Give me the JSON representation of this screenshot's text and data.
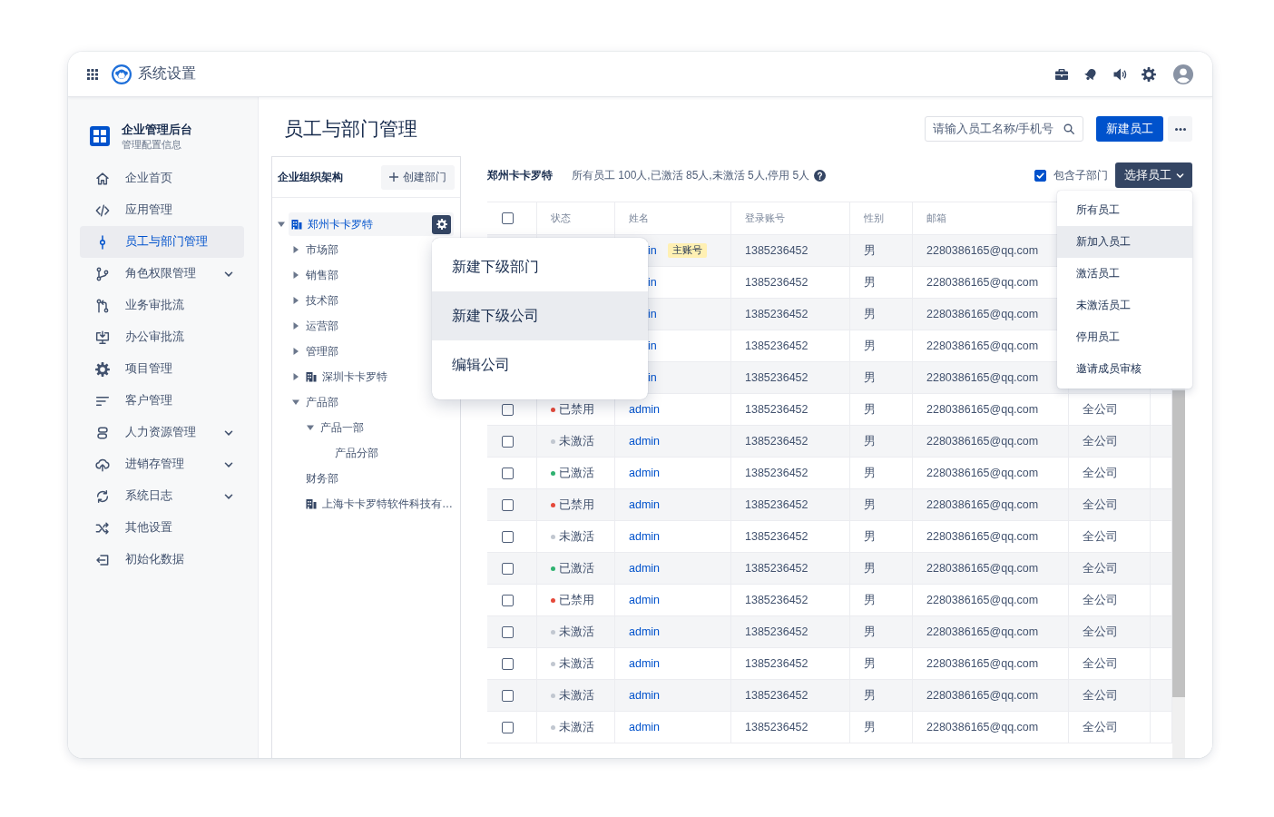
{
  "window": {
    "title": "系统设置"
  },
  "sidebar": {
    "title": "企业管理后台",
    "subtitle": "管理配置信息",
    "items": [
      {
        "label": "企业首页",
        "selected": false,
        "expandable": false
      },
      {
        "label": "应用管理",
        "selected": false,
        "expandable": false
      },
      {
        "label": "员工与部门管理",
        "selected": true,
        "expandable": false
      },
      {
        "label": "角色权限管理",
        "selected": false,
        "expandable": true
      },
      {
        "label": "业务审批流",
        "selected": false,
        "expandable": false
      },
      {
        "label": "办公审批流",
        "selected": false,
        "expandable": false
      },
      {
        "label": "项目管理",
        "selected": false,
        "expandable": false
      },
      {
        "label": "客户管理",
        "selected": false,
        "expandable": false
      },
      {
        "label": "人力资源管理",
        "selected": false,
        "expandable": true
      },
      {
        "label": "进销存管理",
        "selected": false,
        "expandable": true
      },
      {
        "label": "系统日志",
        "selected": false,
        "expandable": true
      },
      {
        "label": "其他设置",
        "selected": false,
        "expandable": false
      },
      {
        "label": "初始化数据",
        "selected": false,
        "expandable": false
      }
    ]
  },
  "page": {
    "title": "员工与部门管理",
    "search": {
      "placeholder": "请输入员工名称/手机号"
    },
    "new_button": "新建员工"
  },
  "org_tree": {
    "title": "企业组织架构",
    "create_button": "创建部门",
    "nodes": [
      {
        "label": "郑州卡卡罗特",
        "kind": "company",
        "selected": true,
        "expanded": true,
        "children": [
          {
            "label": "市场部",
            "kind": "department",
            "selected": false,
            "expanded": false
          },
          {
            "label": "销售部",
            "kind": "department",
            "selected": false,
            "expanded": false
          },
          {
            "label": "技术部",
            "kind": "department",
            "selected": false,
            "expanded": false
          },
          {
            "label": "运营部",
            "kind": "department",
            "selected": false,
            "expanded": false
          },
          {
            "label": "管理部",
            "kind": "department",
            "selected": false,
            "expanded": false
          },
          {
            "label": "深圳卡卡罗特",
            "kind": "company",
            "selected": false,
            "expanded": false
          },
          {
            "label": "产品部",
            "kind": "department",
            "selected": false,
            "expanded": true,
            "children": [
              {
                "label": "产品一部",
                "kind": "department",
                "selected": false,
                "expanded": true,
                "children": [
                  {
                    "label": "产品分部",
                    "kind": "department",
                    "selected": false
                  }
                ]
              }
            ]
          },
          {
            "label": "财务部",
            "kind": "department",
            "selected": false
          },
          {
            "label": "上海卡卡罗特软件科技有…",
            "kind": "company",
            "selected": false
          }
        ]
      }
    ]
  },
  "context_menu": {
    "items": [
      {
        "label": "新建下级部门",
        "highlighted": false
      },
      {
        "label": "新建下级公司",
        "highlighted": true
      },
      {
        "label": "编辑公司",
        "highlighted": false
      }
    ]
  },
  "summary": {
    "org": "郑州卡卡罗特",
    "stats": "所有员工 100人,已激活 85人,未激活 5人,停用 5人"
  },
  "include_sub": {
    "label": "包含子部门",
    "checked": true
  },
  "select_button": "选择员工",
  "select_menu": {
    "items": [
      {
        "label": "所有员工",
        "highlighted": false
      },
      {
        "label": "新加入员工",
        "highlighted": true
      },
      {
        "label": "激活员工",
        "highlighted": false
      },
      {
        "label": "未激活员工",
        "highlighted": false
      },
      {
        "label": "停用员工",
        "highlighted": false
      },
      {
        "label": "邀请成员审核",
        "highlighted": false
      }
    ]
  },
  "table": {
    "header_checkbox": {
      "checked": false
    },
    "columns": [
      "状态",
      "姓名",
      "登录账号",
      "性别",
      "邮箱"
    ],
    "rows": [
      {
        "kind": "partial",
        "name": "in",
        "badge": "主账号",
        "account": "1385236452",
        "gender": "男",
        "email": "2280386165@qq.com"
      },
      {
        "kind": "partial",
        "name": "in",
        "account": "1385236452",
        "gender": "男",
        "email": "2280386165@qq.com"
      },
      {
        "kind": "partial",
        "name": "in",
        "account": "1385236452",
        "gender": "男",
        "email": "2280386165@qq.com"
      },
      {
        "kind": "partial",
        "name": "in",
        "account": "1385236452",
        "gender": "男",
        "email": "2280386165@qq.com"
      },
      {
        "kind": "partial",
        "name": "in",
        "account": "1385236452",
        "gender": "男",
        "email": "2280386165@qq.com"
      },
      {
        "kind": "full",
        "checked": false,
        "status": "已禁用",
        "color": "#e5493a",
        "name": "admin",
        "account": "1385236452",
        "gender": "男",
        "email": "2280386165@qq.com",
        "column_7": "全公司"
      },
      {
        "kind": "full",
        "checked": false,
        "status": "未激活",
        "color": "#c1c7d0",
        "name": "admin",
        "account": "1385236452",
        "gender": "男",
        "email": "2280386165@qq.com",
        "column_7": "全公司"
      },
      {
        "kind": "full",
        "checked": false,
        "status": "已激活",
        "color": "#2fb170",
        "name": "admin",
        "account": "1385236452",
        "gender": "男",
        "email": "2280386165@qq.com",
        "column_7": "全公司"
      },
      {
        "kind": "full",
        "checked": false,
        "status": "已禁用",
        "color": "#e5493a",
        "name": "admin",
        "account": "1385236452",
        "gender": "男",
        "email": "2280386165@qq.com",
        "column_7": "全公司"
      },
      {
        "kind": "full",
        "checked": false,
        "status": "未激活",
        "color": "#c1c7d0",
        "name": "admin",
        "account": "1385236452",
        "gender": "男",
        "email": "2280386165@qq.com",
        "column_7": "全公司"
      },
      {
        "kind": "full",
        "checked": false,
        "status": "已激活",
        "color": "#2fb170",
        "name": "admin",
        "account": "1385236452",
        "gender": "男",
        "email": "2280386165@qq.com",
        "column_7": "全公司"
      },
      {
        "kind": "full",
        "checked": false,
        "status": "已禁用",
        "color": "#e5493a",
        "name": "admin",
        "account": "1385236452",
        "gender": "男",
        "email": "2280386165@qq.com",
        "column_7": "全公司"
      },
      {
        "kind": "full",
        "checked": false,
        "status": "未激活",
        "color": "#c1c7d0",
        "name": "admin",
        "account": "1385236452",
        "gender": "男",
        "email": "2280386165@qq.com",
        "column_7": "全公司"
      },
      {
        "kind": "full",
        "checked": false,
        "status": "未激活",
        "color": "#c1c7d0",
        "name": "admin",
        "account": "1385236452",
        "gender": "男",
        "email": "2280386165@qq.com",
        "column_7": "全公司"
      },
      {
        "kind": "full",
        "checked": false,
        "status": "未激活",
        "color": "#c1c7d0",
        "name": "admin",
        "account": "1385236452",
        "gender": "男",
        "email": "2280386165@qq.com",
        "column_7": "全公司"
      },
      {
        "kind": "full",
        "checked": false,
        "status": "未激活",
        "color": "#c1c7d0",
        "name": "admin",
        "account": "1385236452",
        "gender": "男",
        "email": "2280386165@qq.com",
        "column_7": "全公司"
      }
    ]
  }
}
